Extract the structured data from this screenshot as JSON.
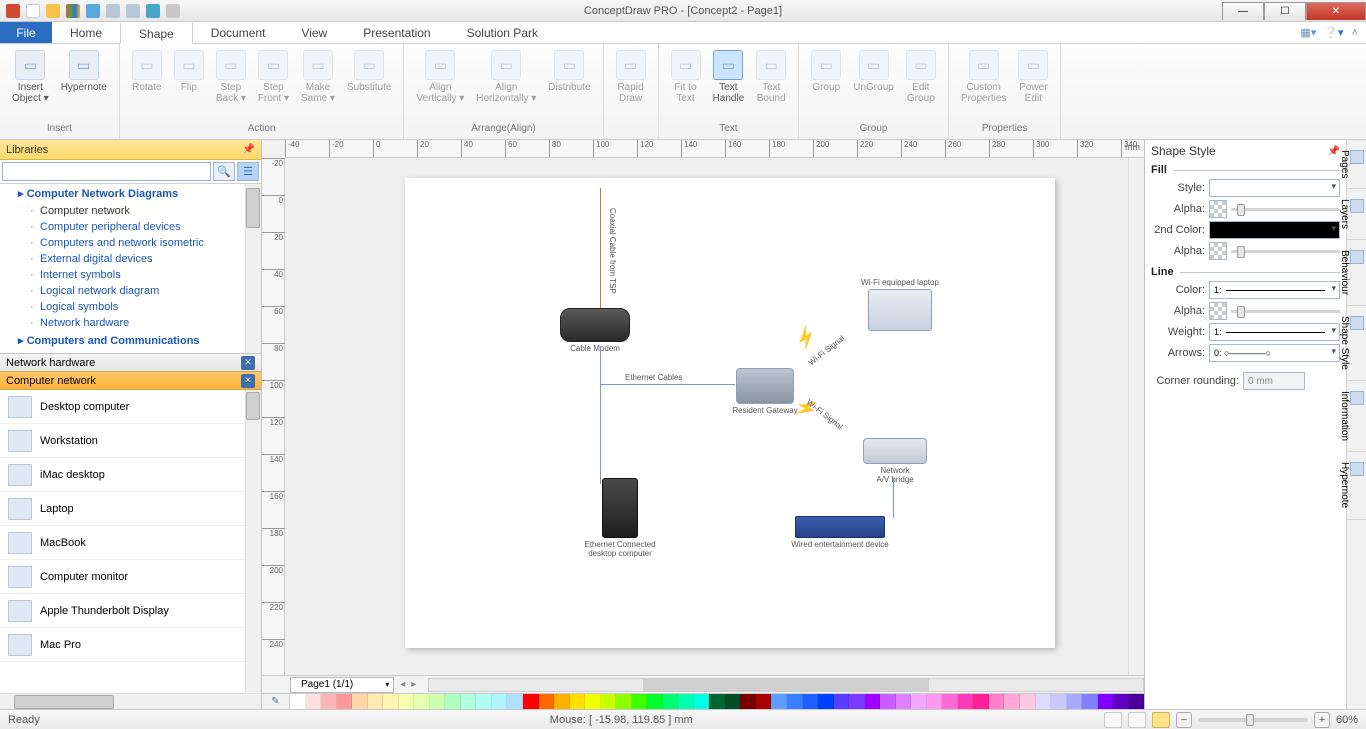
{
  "title": "ConceptDraw PRO - [Concept2 - Page1]",
  "menu": {
    "file": "File",
    "tabs": [
      "Home",
      "Shape",
      "Document",
      "View",
      "Presentation",
      "Solution Park"
    ],
    "selected": "Shape"
  },
  "ribbon": {
    "groups": [
      {
        "label": "Insert",
        "items": [
          {
            "label": "Insert\nObject ▾",
            "name": "insert-object"
          },
          {
            "label": "Hypernote",
            "name": "hypernote"
          }
        ]
      },
      {
        "label": "Action",
        "items": [
          {
            "label": "Rotate",
            "name": "rotate",
            "dim": true
          },
          {
            "label": "Flip",
            "name": "flip",
            "dim": true
          },
          {
            "label": "Step\nBack ▾",
            "name": "step-back",
            "dim": true
          },
          {
            "label": "Step\nFront ▾",
            "name": "step-front",
            "dim": true
          },
          {
            "label": "Make\nSame ▾",
            "name": "make-same",
            "dim": true
          },
          {
            "label": "Substitute",
            "name": "substitute",
            "dim": true
          }
        ]
      },
      {
        "label": "Arrange(Align)",
        "items": [
          {
            "label": "Align\nVertically ▾",
            "name": "align-vert",
            "dim": true
          },
          {
            "label": "Align\nHorizontally ▾",
            "name": "align-horz",
            "dim": true
          },
          {
            "label": "Distribute",
            "name": "distribute",
            "dim": true
          }
        ]
      },
      {
        "label": "",
        "items": [
          {
            "label": "Rapid\nDraw",
            "name": "rapid-draw",
            "dim": true
          }
        ]
      },
      {
        "label": "Text",
        "items": [
          {
            "label": "Fit to\nText",
            "name": "fit-to-text",
            "dim": true
          },
          {
            "label": "Text\nHandle",
            "name": "text-handle",
            "high": true
          },
          {
            "label": "Text\nBound",
            "name": "text-bound",
            "dim": true
          }
        ]
      },
      {
        "label": "Group",
        "items": [
          {
            "label": "Group",
            "name": "group",
            "dim": true
          },
          {
            "label": "UnGroup",
            "name": "ungroup",
            "dim": true
          },
          {
            "label": "Edit\nGroup",
            "name": "edit-group",
            "dim": true
          }
        ]
      },
      {
        "label": "Properties",
        "items": [
          {
            "label": "Custom\nProperties",
            "name": "custom-props",
            "dim": true
          },
          {
            "label": "Power\nEdit",
            "name": "power-edit",
            "dim": true
          }
        ]
      }
    ]
  },
  "libraries": {
    "header": "Libraries",
    "root": "Computer Network Diagrams",
    "items": [
      "Computer network",
      "Computer peripheral devices",
      "Computers and network isometric",
      "External digital devices",
      "Internet symbols",
      "Logical network diagram",
      "Logical symbols",
      "Network hardware"
    ],
    "more": "Computers and Communications",
    "selected": "Computer network",
    "stencil_headers": [
      {
        "text": "Network hardware",
        "style": "grey"
      },
      {
        "text": "Computer network",
        "style": "orange"
      }
    ],
    "stencils": [
      "Desktop computer",
      "Workstation",
      "iMac desktop",
      "Laptop",
      "MacBook",
      "Computer monitor",
      "Apple Thunderbolt Display",
      "Mac Pro"
    ]
  },
  "canvas": {
    "ruler_unit": "mm",
    "page_tab": "Page1 (1/1)",
    "nodes": {
      "cable_modem": {
        "label": "Cable Modem"
      },
      "gateway": {
        "label": "Resident Gateway"
      },
      "laptop": {
        "label": "Wi-Fi equipped laptop"
      },
      "bridge": {
        "label1": "Network",
        "label2": "A/V bridge"
      },
      "wired_ent": {
        "label": "Wired entertainment device"
      },
      "desktop": {
        "label1": "Ethernet Connected",
        "label2": "desktop computer"
      }
    },
    "link_labels": {
      "coax1": "Coaxial Cable",
      "coax2": "from TSP",
      "eth": "Ethernet Cables",
      "wifi": "Wi-Fi Signal"
    }
  },
  "shapestyle": {
    "title": "Shape Style",
    "fill": "Fill",
    "style": "Style:",
    "alpha": "Alpha:",
    "second": "2nd Color:",
    "line": "Line",
    "color": "Color:",
    "weight": "Weight:",
    "weight_val": "1:",
    "arrows": "Arrows:",
    "corner": "Corner rounding:",
    "corner_val": "0 mm"
  },
  "sidetabs": [
    "Pages",
    "Layers",
    "Behaviour",
    "Shape Style",
    "Information",
    "Hypernote"
  ],
  "palette_tool": "✎",
  "palette": [
    "#ffffff",
    "#ffe0e0",
    "#ffb6b6",
    "#ff9a9a",
    "#ffd6a8",
    "#ffe9b0",
    "#fff3b0",
    "#f6ffb0",
    "#e4ffb0",
    "#ccffb0",
    "#b0ffc0",
    "#b0ffe0",
    "#b0fff4",
    "#b0f4ff",
    "#b0e0ff",
    "#ff0000",
    "#ff6a00",
    "#ffb000",
    "#ffe000",
    "#f2ff00",
    "#c8ff00",
    "#8cff00",
    "#3cff00",
    "#00ff2a",
    "#00ff74",
    "#00ffb0",
    "#00ffe4",
    "#006633",
    "#004d26",
    "#7a0000",
    "#a80000",
    "#5c9eff",
    "#3a7fff",
    "#1f5fff",
    "#0040ff",
    "#5c3aff",
    "#7a3aff",
    "#a000ff",
    "#c85cff",
    "#e080ff",
    "#f0a8ff",
    "#ff9af0",
    "#ff6ad6",
    "#ff3ab8",
    "#ff1f9a",
    "#ff80c8",
    "#ffa8d6",
    "#ffc8e4",
    "#dcdcff",
    "#c8c8ff",
    "#a8a8ff",
    "#8080ff",
    "#8000ff",
    "#6000c0",
    "#4a0094"
  ],
  "status": {
    "ready": "Ready",
    "mouse_label": "Mouse: ",
    "mouse_val": "[ -15.98, 119.85 ] mm",
    "zoom": "60%"
  }
}
